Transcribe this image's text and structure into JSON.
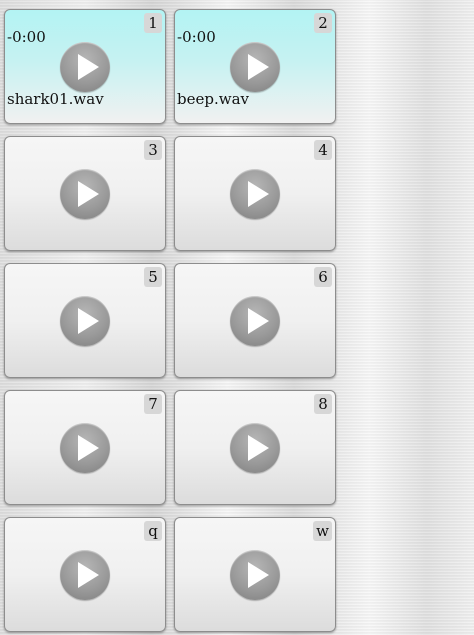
{
  "pads": [
    {
      "key": "1",
      "time": "-0:00",
      "filename": "shark01.wav",
      "loaded": true
    },
    {
      "key": "2",
      "time": "-0:00",
      "filename": "beep.wav",
      "loaded": true
    },
    {
      "key": "3",
      "time": "",
      "filename": "",
      "loaded": false
    },
    {
      "key": "4",
      "time": "",
      "filename": "",
      "loaded": false
    },
    {
      "key": "5",
      "time": "",
      "filename": "",
      "loaded": false
    },
    {
      "key": "6",
      "time": "",
      "filename": "",
      "loaded": false
    },
    {
      "key": "7",
      "time": "",
      "filename": "",
      "loaded": false
    },
    {
      "key": "8",
      "time": "",
      "filename": "",
      "loaded": false
    },
    {
      "key": "q",
      "time": "",
      "filename": "",
      "loaded": false
    },
    {
      "key": "w",
      "time": "",
      "filename": "",
      "loaded": false
    }
  ],
  "icons": {
    "play": "play-icon"
  }
}
